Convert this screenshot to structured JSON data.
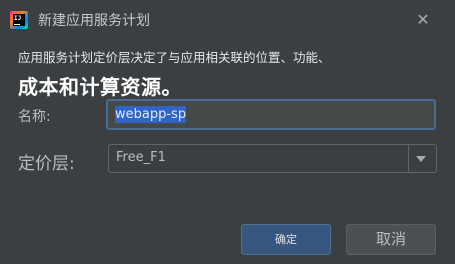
{
  "dialog": {
    "title": "新建应用服务计划",
    "close_symbol": "✕",
    "app_icon_text": "IJ"
  },
  "description": {
    "line1": "应用服务计划定价层决定了与应用相关联的位置、功能、",
    "line2": "成本和计算资源。"
  },
  "form": {
    "name_label": "名称:",
    "name_value": "webapp-sp",
    "tier_label": "定价层:",
    "tier_value": "Free_F1"
  },
  "buttons": {
    "ok": "确定",
    "cancel": "取消"
  },
  "colors": {
    "background": "#3c3f41",
    "primary_button": "#365880",
    "focus_border": "#466d94",
    "selection": "#2f65ca"
  },
  "icons": {
    "app": "intellij-idea-icon",
    "close": "close-icon",
    "dropdown": "chevron-down-icon"
  }
}
